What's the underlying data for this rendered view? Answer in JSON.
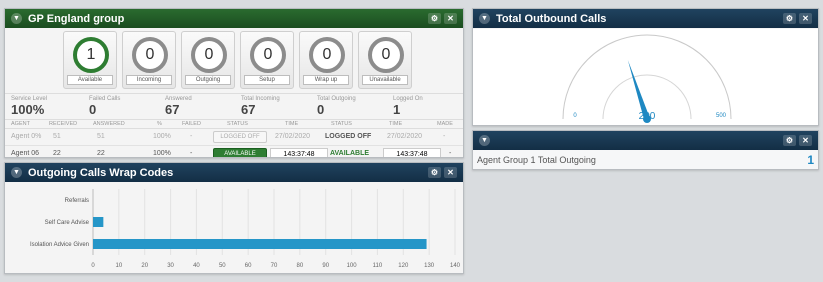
{
  "group_panel": {
    "title": "GP England group",
    "circles": [
      {
        "count": "1",
        "label": "Available"
      },
      {
        "count": "0",
        "label": "Incoming"
      },
      {
        "count": "0",
        "label": "Outgoing"
      },
      {
        "count": "0",
        "label": "Setup"
      },
      {
        "count": "0",
        "label": "Wrap up"
      },
      {
        "count": "0",
        "label": "Unavailable"
      }
    ],
    "stats": [
      {
        "label": "Service Level",
        "value": "100%"
      },
      {
        "label": "Failed Calls",
        "value": "0"
      },
      {
        "label": "Answered",
        "value": "67"
      },
      {
        "label": "Total Incoming",
        "value": "67"
      },
      {
        "label": "Total Outgoing",
        "value": "0"
      },
      {
        "label": "Logged On",
        "value": "1"
      }
    ],
    "columns": [
      "AGENT",
      "RECEIVED",
      "ANSWERED",
      "%",
      "FAILED",
      "STATUS",
      "TIME",
      "STATUS",
      "TIME",
      "MADE"
    ],
    "rows": [
      {
        "agent": "Agent 0%",
        "received": "51",
        "answered": "51",
        "pct": "100%",
        "failed": "-",
        "status": "LOGGED OFF",
        "time": "27/02/2020",
        "status2": "LOGGED OFF",
        "time2": "27/02/2020",
        "made": "-"
      },
      {
        "agent": "Agent 06",
        "received": "22",
        "answered": "22",
        "pct": "100%",
        "failed": "-",
        "status": "AVAILABLE",
        "time": "143:37:48",
        "status2": "AVAILABLE",
        "time2": "143:37:48",
        "made": "-"
      }
    ]
  },
  "wrap_panel": {
    "title": "Outgoing Calls Wrap Codes"
  },
  "chart_data": {
    "type": "bar",
    "orientation": "horizontal",
    "categories": [
      "Referrals",
      "Self Care Advise",
      "Isolation Advice Given"
    ],
    "values": [
      0,
      4,
      129
    ],
    "xlim": [
      0,
      140
    ],
    "xticks": [
      "0",
      "10",
      "20",
      "30",
      "40",
      "50",
      "60",
      "70",
      "80",
      "90",
      "100",
      "110",
      "120",
      "130",
      "140"
    ],
    "grid": true,
    "bar_color": "#2596c8"
  },
  "outbound_panel": {
    "title": "Total Outbound Calls",
    "gauge": {
      "value": "200",
      "min": "0",
      "max": "500",
      "value_num": 200,
      "max_num": 500
    }
  },
  "agent_group_panel": {
    "title": "",
    "row_label": "Agent Group 1 Total Outgoing",
    "row_value": "1"
  }
}
